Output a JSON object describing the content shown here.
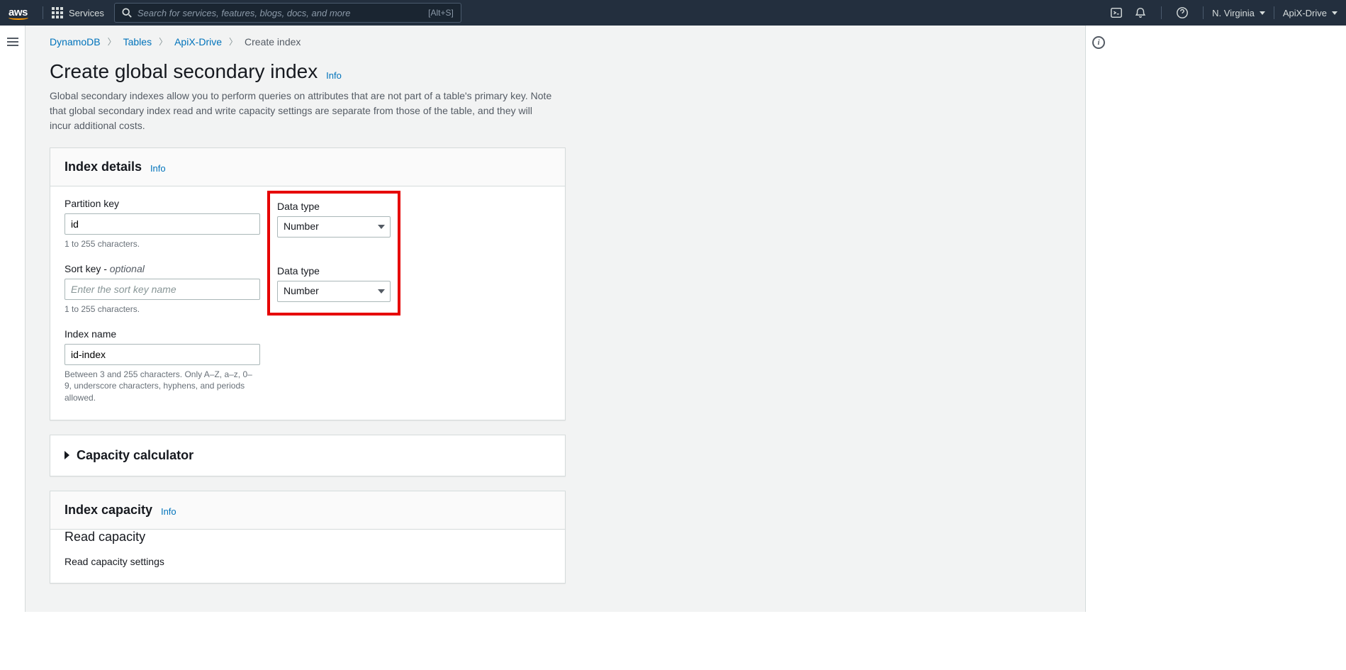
{
  "nav": {
    "logo_text": "aws",
    "services": "Services",
    "search_placeholder": "Search for services, features, blogs, docs, and more",
    "search_shortcut": "[Alt+S]",
    "region": "N. Virginia",
    "account": "ApiX-Drive"
  },
  "breadcrumb": {
    "items": [
      "DynamoDB",
      "Tables",
      "ApiX-Drive",
      "Create index"
    ]
  },
  "header": {
    "title": "Create global secondary index",
    "info": "Info",
    "description": "Global secondary indexes allow you to perform queries on attributes that are not part of a table's primary key. Note that global secondary index read and write capacity settings are separate from those of the table, and they will incur additional costs."
  },
  "index_details": {
    "title": "Index details",
    "info": "Info",
    "partition_key_label": "Partition key",
    "partition_key_value": "id",
    "partition_key_hint": "1 to 255 characters.",
    "data_type_label_1": "Data type",
    "data_type_value_1": "Number",
    "sort_key_label": "Sort key - ",
    "sort_key_optional": "optional",
    "sort_key_placeholder": "Enter the sort key name",
    "sort_key_hint": "1 to 255 characters.",
    "data_type_label_2": "Data type",
    "data_type_value_2": "Number",
    "index_name_label": "Index name",
    "index_name_value": "id-index",
    "index_name_hint": "Between 3 and 255 characters. Only A–Z, a–z, 0–9, underscore characters, hyphens, and periods allowed."
  },
  "capacity_calc": {
    "title": "Capacity calculator"
  },
  "index_capacity": {
    "title": "Index capacity",
    "info": "Info",
    "read_heading": "Read capacity",
    "read_sub": "Read capacity settings"
  }
}
